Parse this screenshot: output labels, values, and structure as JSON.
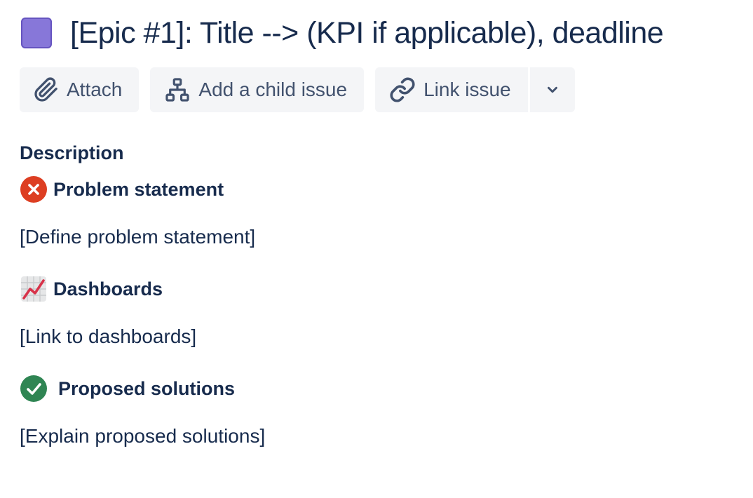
{
  "issue": {
    "title": "[Epic #1]: Title --> (KPI if applicable), deadline",
    "type_color": "#8777d9"
  },
  "toolbar": {
    "attach_label": "Attach",
    "attach_icon": "paperclip-icon",
    "child_label": "Add a child issue",
    "child_icon": "hierarchy-icon",
    "link_label": "Link issue",
    "link_icon": "link-icon",
    "more_icon": "chevron-down-icon"
  },
  "description": {
    "label": "Description",
    "sections": [
      {
        "icon": "cross-mark-icon",
        "icon_color": "#de350b",
        "heading": "Problem statement",
        "body": "[Define problem statement]"
      },
      {
        "icon": "chart-increasing-icon",
        "icon_color": "#dd2e44",
        "heading": "Dashboards",
        "body": "[Link to dashboards]"
      },
      {
        "icon": "check-mark-icon",
        "icon_color": "#36b37e",
        "heading": "Proposed solutions",
        "body": "[Explain proposed solutions]"
      }
    ]
  }
}
